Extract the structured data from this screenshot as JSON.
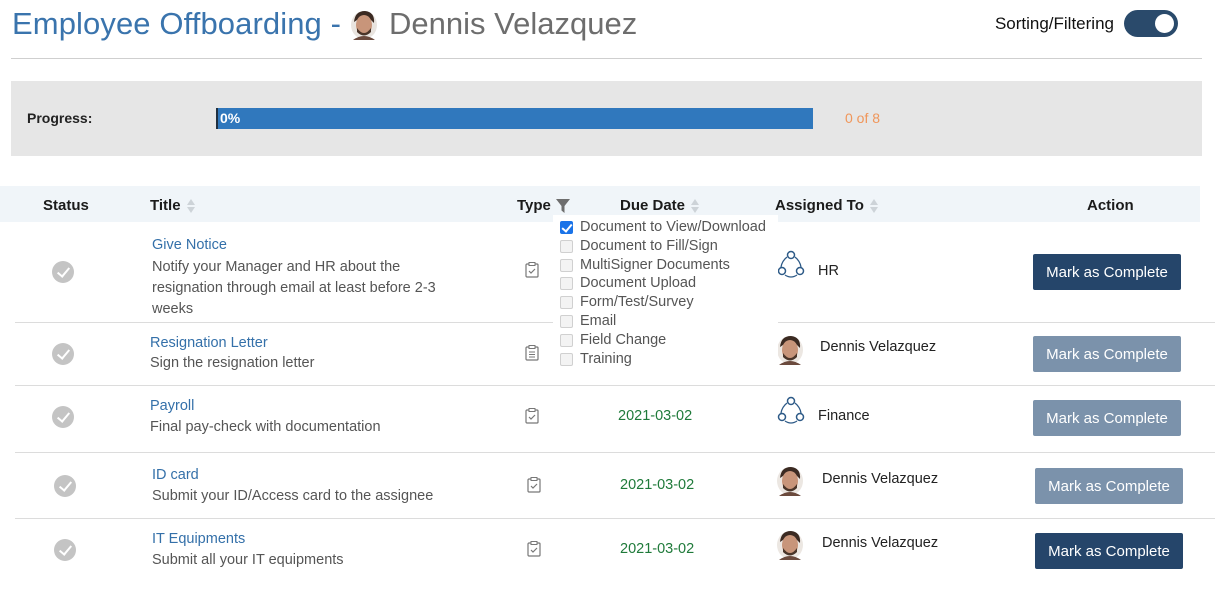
{
  "header": {
    "title": "Employee Offboarding -",
    "employee_name": "Dennis Velazquez",
    "sorting_label": "Sorting/Filtering",
    "sorting_enabled": true
  },
  "progress": {
    "label": "Progress:",
    "percent_text": "0%",
    "count_text": "0 of 8",
    "value": 0
  },
  "table": {
    "columns": {
      "status": "Status",
      "title": "Title",
      "type": "Type",
      "due_date": "Due Date",
      "assigned_to": "Assigned To",
      "action": "Action"
    },
    "rows": [
      {
        "title": "Give Notice",
        "description_lines": [
          "Notify your Manager and HR about the",
          "resignation through email at least before 2-3",
          "weeks"
        ],
        "type_icon": "clipboard-check-icon",
        "due_date": "",
        "assignee": "HR",
        "assignee_icon": "group-icon",
        "action_label": "Mark as Complete",
        "action_style": "dark"
      },
      {
        "title": "Resignation Letter",
        "description_lines": [
          "Sign the resignation letter"
        ],
        "type_icon": "clipboard-list-icon",
        "due_date": "",
        "assignee": "Dennis Velazquez",
        "assignee_icon": "avatar",
        "action_label": "Mark as Complete",
        "action_style": "light"
      },
      {
        "title": "Payroll",
        "description_lines": [
          "Final pay-check with documentation"
        ],
        "type_icon": "clipboard-check-icon",
        "due_date": "2021-03-02",
        "assignee": "Finance",
        "assignee_icon": "group-icon",
        "action_label": "Mark as Complete",
        "action_style": "light"
      },
      {
        "title": "ID card",
        "description_lines": [
          "Submit your ID/Access card to the assignee"
        ],
        "type_icon": "clipboard-check-icon",
        "due_date": "2021-03-02",
        "assignee": "Dennis Velazquez",
        "assignee_icon": "avatar",
        "action_label": "Mark as Complete",
        "action_style": "light"
      },
      {
        "title": "IT Equipments",
        "description_lines": [
          "Submit all your IT equipments"
        ],
        "type_icon": "clipboard-check-icon",
        "due_date": "2021-03-02",
        "assignee": "Dennis Velazquez",
        "assignee_icon": "avatar",
        "action_label": "Mark as Complete",
        "action_style": "dark"
      }
    ]
  },
  "type_filter": {
    "options": [
      {
        "label": "Document to View/Download",
        "checked": true
      },
      {
        "label": "Document to Fill/Sign",
        "checked": false
      },
      {
        "label": "MultiSigner Documents",
        "checked": false
      },
      {
        "label": "Document Upload",
        "checked": false
      },
      {
        "label": "Form/Test/Survey",
        "checked": false
      },
      {
        "label": "Email",
        "checked": false
      },
      {
        "label": "Field Change",
        "checked": false
      },
      {
        "label": "Training",
        "checked": false
      }
    ]
  },
  "colors": {
    "title_blue": "#3a74ad",
    "progress_blue": "#3078bd",
    "progress_count": "#f0965a",
    "due_green": "#1f7a3a",
    "button_dark": "#25456a",
    "button_light": "#7b92ab"
  }
}
